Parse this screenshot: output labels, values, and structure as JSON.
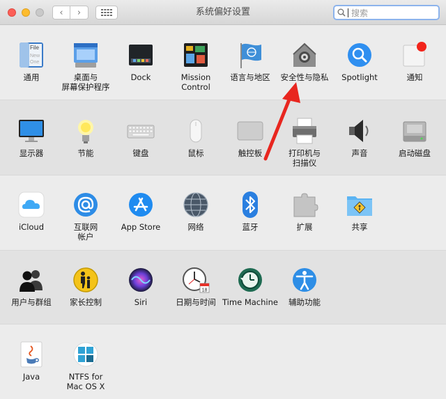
{
  "window": {
    "title": "系统偏好设置",
    "search_placeholder": "搜索",
    "back_glyph": "‹",
    "forward_glyph": "›"
  },
  "rows": [
    {
      "items": [
        {
          "id": "general",
          "label": "通用",
          "icon": "general-icon",
          "file_text": "File",
          "new_text": "New",
          "one_text": "One"
        },
        {
          "id": "desktop",
          "label": "桌面与\n屏幕保护程序",
          "icon": "desktop-screensaver-icon"
        },
        {
          "id": "dock",
          "label": "Dock",
          "icon": "dock-icon"
        },
        {
          "id": "mission-control",
          "label": "Mission\nControl",
          "icon": "mission-control-icon"
        },
        {
          "id": "language",
          "label": "语言与地区",
          "icon": "language-region-icon"
        },
        {
          "id": "security",
          "label": "安全性与隐私",
          "icon": "security-privacy-icon"
        },
        {
          "id": "spotlight",
          "label": "Spotlight",
          "icon": "spotlight-icon"
        },
        {
          "id": "notifications",
          "label": "通知",
          "icon": "notifications-icon"
        }
      ]
    },
    {
      "items": [
        {
          "id": "displays",
          "label": "显示器",
          "icon": "displays-icon"
        },
        {
          "id": "energy",
          "label": "节能",
          "icon": "energy-saver-icon"
        },
        {
          "id": "keyboard",
          "label": "键盘",
          "icon": "keyboard-icon"
        },
        {
          "id": "mouse",
          "label": "鼠标",
          "icon": "mouse-icon"
        },
        {
          "id": "trackpad",
          "label": "触控板",
          "icon": "trackpad-icon"
        },
        {
          "id": "printers",
          "label": "打印机与\n扫描仪",
          "icon": "printers-scanners-icon"
        },
        {
          "id": "sound",
          "label": "声音",
          "icon": "sound-icon"
        },
        {
          "id": "startup-disk",
          "label": "启动磁盘",
          "icon": "startup-disk-icon"
        }
      ]
    },
    {
      "items": [
        {
          "id": "icloud",
          "label": "iCloud",
          "icon": "icloud-icon"
        },
        {
          "id": "internet-accounts",
          "label": "互联网\n帐户",
          "icon": "internet-accounts-icon"
        },
        {
          "id": "app-store",
          "label": "App Store",
          "icon": "app-store-icon"
        },
        {
          "id": "network",
          "label": "网络",
          "icon": "network-icon"
        },
        {
          "id": "bluetooth",
          "label": "蓝牙",
          "icon": "bluetooth-icon"
        },
        {
          "id": "extensions",
          "label": "扩展",
          "icon": "extensions-icon"
        },
        {
          "id": "sharing",
          "label": "共享",
          "icon": "sharing-icon"
        }
      ]
    },
    {
      "items": [
        {
          "id": "users-groups",
          "label": "用户与群组",
          "icon": "users-groups-icon"
        },
        {
          "id": "parental-controls",
          "label": "家长控制",
          "icon": "parental-controls-icon"
        },
        {
          "id": "siri",
          "label": "Siri",
          "icon": "siri-icon"
        },
        {
          "id": "date-time",
          "label": "日期与时间",
          "icon": "date-time-icon",
          "calendar_day": "18"
        },
        {
          "id": "time-machine",
          "label": "Time Machine",
          "icon": "time-machine-icon"
        },
        {
          "id": "accessibility",
          "label": "辅助功能",
          "icon": "accessibility-icon"
        }
      ]
    },
    {
      "items": [
        {
          "id": "java",
          "label": "Java",
          "icon": "java-icon"
        },
        {
          "id": "ntfs",
          "label": "NTFS for\nMac OS X",
          "icon": "ntfs-icon"
        }
      ]
    }
  ],
  "annotation": {
    "arrow_color": "#e8261f"
  }
}
